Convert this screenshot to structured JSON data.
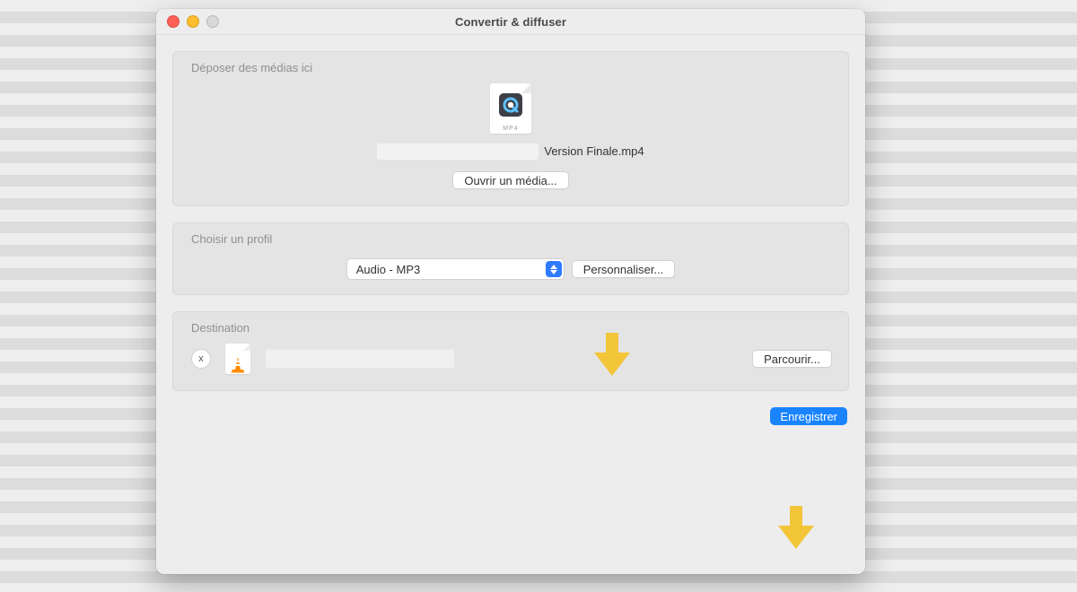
{
  "window": {
    "title": "Convertir & diffuser"
  },
  "drop": {
    "title": "Déposer des médias ici",
    "file_type": "MP4",
    "file_name": "Version Finale.mp4",
    "open_label": "Ouvrir un média..."
  },
  "profile": {
    "title": "Choisir un profil",
    "selected": "Audio - MP3",
    "customize_label": "Personnaliser..."
  },
  "destination": {
    "title": "Destination",
    "clear_label": "x",
    "browse_label": "Parcourir..."
  },
  "actions": {
    "save_label": "Enregistrer"
  }
}
